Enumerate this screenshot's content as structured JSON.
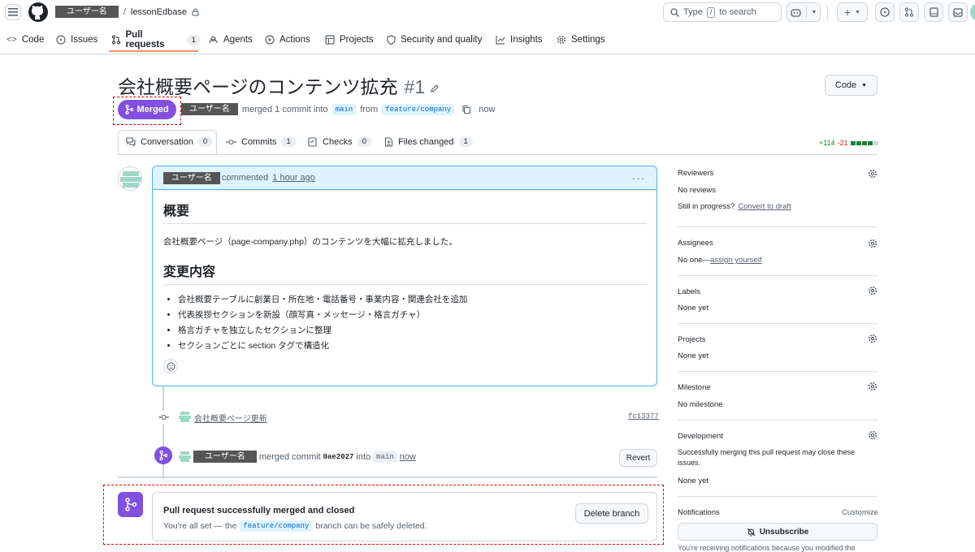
{
  "header": {
    "owner": "ユーザー名",
    "repo": "lessonEdbase",
    "search_placeholder_prefix": "Type",
    "search_key": "/",
    "search_placeholder_suffix": "to search"
  },
  "nav": {
    "tabs": [
      {
        "label": "Code"
      },
      {
        "label": "Issues"
      },
      {
        "label": "Pull requests",
        "count": "1"
      },
      {
        "label": "Agents"
      },
      {
        "label": "Actions"
      },
      {
        "label": "Projects"
      },
      {
        "label": "Security and quality"
      },
      {
        "label": "Insights"
      },
      {
        "label": "Settings"
      }
    ]
  },
  "pr": {
    "title": "会社概要ページのコンテンツ拡充",
    "number": "#1",
    "state": "Merged",
    "author": "ユーザー名",
    "merged_text": "merged 1 commit into",
    "base": "main",
    "from_text": "from",
    "head": "feature/company",
    "time": "now",
    "code_button": "Code",
    "diff_add": "+114",
    "diff_del": "-21"
  },
  "pr_tabs": [
    {
      "label": "Conversation",
      "count": "0"
    },
    {
      "label": "Commits",
      "count": "1"
    },
    {
      "label": "Checks",
      "count": "0"
    },
    {
      "label": "Files changed",
      "count": "1"
    }
  ],
  "comment": {
    "author": "ユーザー名",
    "action": "commented",
    "time": "1 hour ago",
    "h1": "概要",
    "p1": "会社概要ページ（page-company.php）のコンテンツを大幅に拡充しました。",
    "h2": "変更内容",
    "items": [
      "会社概要テーブルに創業日・所在地・電話番号・事業内容・関連会社を追加",
      "代表挨拶セクションを新設（顔写真・メッセージ・格言ガチャ）",
      "格言ガチャを独立したセクションに整理",
      "セクションごとに section タグで構造化"
    ]
  },
  "commit": {
    "message": "会社概要ページ更新",
    "sha": "fc13377"
  },
  "merge_event": {
    "author": "ユーザー名",
    "text": "merged commit",
    "sha": "0ae2027",
    "into": "into",
    "branch": "main",
    "time": "now",
    "revert": "Revert"
  },
  "merged_box": {
    "title": "Pull request successfully merged and closed",
    "pre": "You're all set — the",
    "branch": "feature/company",
    "post": "branch can be safely deleted.",
    "button": "Delete branch"
  },
  "sidebar": {
    "reviewers": {
      "title": "Reviewers",
      "value": "No reviews",
      "hint": "Still in progress?",
      "link": "Convert to draft"
    },
    "assignees": {
      "title": "Assignees",
      "value": "No one—",
      "link": "assign yourself"
    },
    "labels": {
      "title": "Labels",
      "value": "None yet"
    },
    "projects": {
      "title": "Projects",
      "value": "None yet"
    },
    "milestone": {
      "title": "Milestone",
      "value": "No milestone"
    },
    "development": {
      "title": "Development",
      "desc": "Successfully merging this pull request may close these issues.",
      "value": "None yet"
    },
    "notifications": {
      "title": "Notifications",
      "customize": "Customize",
      "button": "Unsubscribe",
      "note": "You're receiving notifications because you modified the"
    }
  },
  "colors": {
    "merged": "#8250df",
    "accent": "#0969da",
    "add": "#1a7f37",
    "del": "#cf222e"
  }
}
